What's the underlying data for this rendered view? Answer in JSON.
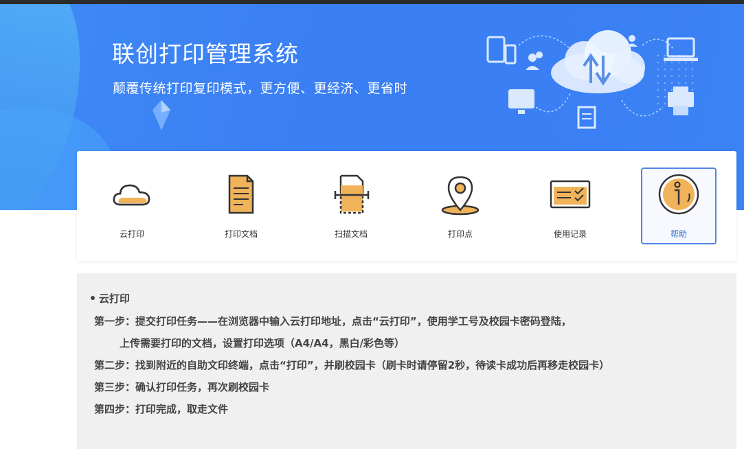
{
  "hero": {
    "title": "联创打印管理系统",
    "subtitle": "颠覆传统打印复印模式，更方便、更经济、更省时"
  },
  "menu": {
    "items": [
      {
        "label": "云打印",
        "icon": "cloud-icon"
      },
      {
        "label": "打印文档",
        "icon": "document-icon"
      },
      {
        "label": "扫描文档",
        "icon": "scan-icon"
      },
      {
        "label": "打印点",
        "icon": "location-pin-icon"
      },
      {
        "label": "使用记录",
        "icon": "records-icon"
      },
      {
        "label": "帮助",
        "icon": "info-icon",
        "active": true
      }
    ]
  },
  "help": {
    "heading": "云打印",
    "steps": [
      "第一步：提交打印任务——在浏览器中输入云打印地址，点击“云打印”，使用学工号及校园卡密码登陆，",
      "上传需要打印的文档，设置打印选项（A4/A4，黑白/彩色等）",
      "第二步：找到附近的自助文印终端，点击“打印”，并刷校园卡（刷卡时请停留2秒，待读卡成功后再移走校园卡）",
      "第三步：确认打印任务，再次刷校园卡",
      "第四步：打印完成，取走文件"
    ]
  },
  "colors": {
    "hero_blue": "#3b82f5",
    "icon_orange": "#f0b35a",
    "active_border": "#4f86e6"
  }
}
